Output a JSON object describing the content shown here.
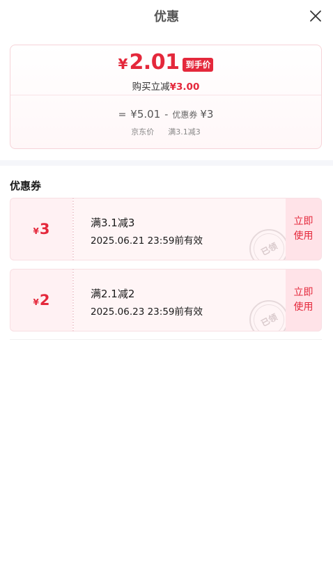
{
  "header": {
    "title": "优惠"
  },
  "summary": {
    "currency": "¥",
    "final_price": "2.01",
    "price_badge": "到手价",
    "instant_label": "购买立减",
    "instant_amount": "¥3.00",
    "formula": {
      "eq": "=",
      "orig_price": "¥5.01",
      "minus": "-",
      "coupon_label": "优惠券",
      "coupon_value": "¥3",
      "orig_caption": "京东价",
      "coupon_caption": "满3.1减3"
    }
  },
  "section": {
    "title": "优惠券"
  },
  "coupons": [
    {
      "currency": "¥",
      "value": "3",
      "name": "满3.1减3",
      "expiry": "2025.06.21 23:59前有效",
      "stamp": "已领",
      "btn_line1": "立即",
      "btn_line2": "使用"
    },
    {
      "currency": "¥",
      "value": "2",
      "name": "满2.1减2",
      "expiry": "2025.06.23 23:59前有效",
      "stamp": "已领",
      "btn_line1": "立即",
      "btn_line2": "使用"
    }
  ],
  "colors": {
    "accent": "#e4283b",
    "coupon_bg": "#fff5f6",
    "coupon_btn_bg": "#ffe3e8"
  },
  "icons": {
    "close": "close-icon"
  }
}
